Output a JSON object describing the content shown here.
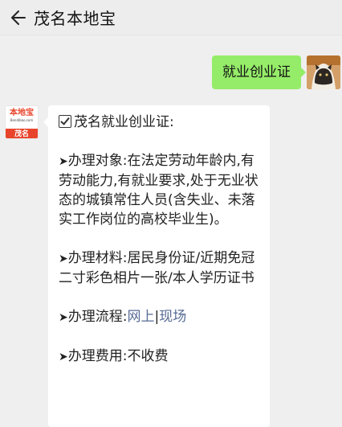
{
  "header": {
    "title": "茂名本地宝"
  },
  "chat": {
    "user_message": "就业创业证",
    "bot_logo": {
      "name": "本地宝",
      "url": "Bendibao.com",
      "city": "茂名"
    },
    "bot_message": {
      "heading": "茂名就业创业证:",
      "sections": [
        {
          "marker": "➤",
          "text": "办理对象:在法定劳动年龄内,有劳动能力,有就业要求,处于无业状态的城镇常住人员(含失业、未落实工作岗位的高校毕业生)。"
        },
        {
          "marker": "➤",
          "text": "办理材料:居民身份证/近期免冠二寸彩色相片一张/本人学历证书"
        },
        {
          "marker": "➤",
          "label": "办理流程:",
          "link1": "网上",
          "separator": "|",
          "link2": "现场"
        },
        {
          "marker": "➤",
          "text": "办理费用:不收费"
        }
      ]
    }
  },
  "colors": {
    "user_bubble": "#95ec69",
    "link": "#576b95",
    "brand": "#e8442b"
  }
}
